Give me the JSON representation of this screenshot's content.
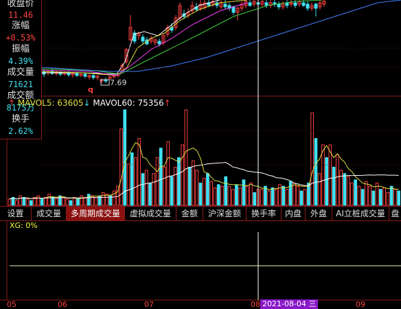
{
  "info_panel": {
    "items": [
      {
        "label": "收盘价",
        "value": "11.46",
        "color": "red"
      },
      {
        "label": "涨幅",
        "value": "+0.53%",
        "color": "red"
      },
      {
        "label": "振幅",
        "value": "4.39%",
        "color": "cyan"
      },
      {
        "label": "成交量",
        "value": "71621",
        "color": "cyan"
      },
      {
        "label": "成交额",
        "value": "8175万",
        "color": "cyan"
      },
      {
        "label": "换手",
        "value": "2.62%",
        "color": "cyan"
      }
    ]
  },
  "price_chart": {
    "low_price_label": "7.69",
    "marker_q": "q"
  },
  "volume_chart": {
    "mavol5_label": "MAVOL5:",
    "mavol5_value": "63605",
    "mavol60_label": "MAVOL60:",
    "mavol60_value": "75356",
    "up_arrow": "↑",
    "down_arrow": "↓",
    "bar_values": [
      4,
      5,
      3,
      6,
      5,
      4,
      3,
      5,
      6,
      4,
      5,
      7,
      5,
      4,
      6,
      5,
      4,
      3,
      5,
      4,
      6,
      5,
      7,
      6,
      5,
      6,
      8,
      7,
      6,
      9,
      12,
      48,
      60,
      26,
      33,
      30,
      42,
      20,
      22,
      14,
      20,
      30,
      36,
      24,
      40,
      18,
      24,
      30,
      38,
      60,
      24,
      28,
      22,
      14,
      17,
      20,
      15,
      11,
      13,
      12,
      18,
      12,
      10,
      13,
      11,
      16,
      12,
      14,
      8,
      10,
      10,
      12,
      9,
      11,
      10,
      13,
      12,
      10,
      15,
      14,
      12,
      9,
      10,
      14,
      58,
      42,
      20,
      38,
      30,
      38,
      24,
      32,
      22,
      20,
      18,
      14,
      16,
      12,
      10,
      15,
      12,
      9,
      14,
      10,
      11,
      8,
      12,
      10,
      9
    ],
    "up_pattern": [
      1,
      0,
      1,
      1,
      0,
      1,
      0,
      1,
      1,
      0,
      1,
      1,
      0,
      1,
      0,
      1,
      1,
      0,
      1,
      0,
      1,
      1,
      0,
      1,
      1,
      0,
      1,
      1,
      0,
      1,
      1,
      1,
      0,
      1,
      0,
      1,
      1,
      0,
      1,
      0,
      1,
      1,
      0,
      1,
      1,
      0,
      1,
      0,
      1,
      1,
      0,
      1,
      1,
      0,
      1,
      0,
      1,
      1,
      0,
      1,
      0,
      1,
      1,
      0,
      1,
      0,
      1,
      1,
      0,
      1,
      1,
      0,
      1,
      0,
      1,
      1,
      0,
      1,
      0,
      1,
      1,
      0,
      1,
      0,
      1,
      0,
      1,
      1,
      0,
      1,
      0,
      1,
      1,
      0,
      1,
      1,
      0,
      1,
      0,
      1,
      1,
      0,
      1,
      0,
      1,
      1,
      0,
      1,
      0
    ]
  },
  "tabs": [
    {
      "label": "设置",
      "active": false
    },
    {
      "label": "成交量",
      "active": false
    },
    {
      "label": "多周期成交量",
      "active": true
    },
    {
      "label": "虚拟成交量",
      "active": false
    },
    {
      "label": "金额",
      "active": false
    },
    {
      "label": "沪深金额",
      "active": false
    },
    {
      "label": "换手率",
      "active": false
    },
    {
      "label": "内盘",
      "active": false
    },
    {
      "label": "外盘",
      "active": false
    },
    {
      "label": "AI立桩成交量",
      "active": false
    },
    {
      "label": "盘",
      "active": false
    }
  ],
  "indicator": {
    "label": "XG: 0%"
  },
  "x_axis": {
    "months": [
      "05",
      "06",
      "07",
      "08",
      "09"
    ],
    "selected_date": "2021-08-04",
    "selected_date_suffix": "三"
  },
  "colors": {
    "up": "#ff4040",
    "down": "#40e0f0",
    "ma_yellow": "#e0e040",
    "ma_white": "#ffffff",
    "ma_magenta": "#ff40ff",
    "ma_green": "#40d040",
    "ma_blue": "#4080ff",
    "frame": "#8a1a1a",
    "active_tab": "#8a1010",
    "date_badge": "#8a18c8"
  }
}
